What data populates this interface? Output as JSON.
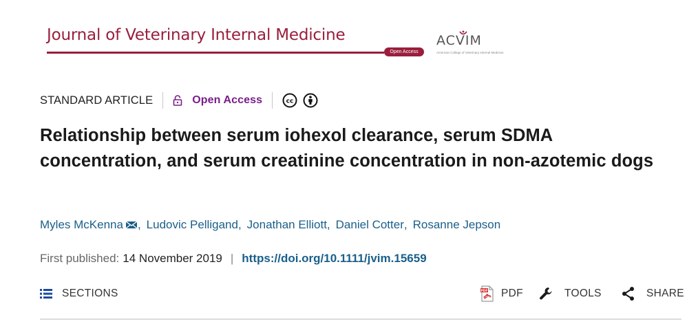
{
  "journal": {
    "title": "Journal of Veterinary Internal Medicine",
    "open_access_badge": "Open Access",
    "society_logo": "ACVIM",
    "society_name": "American College of Veterinary Internal Medicine",
    "brand_color": "#9a1e3c"
  },
  "article": {
    "type": "STANDARD ARTICLE",
    "access": "Open Access",
    "license_icons": [
      "cc-icon",
      "cc-by-icon"
    ],
    "title": "Relationship between serum iohexol clearance, serum SDMA concentration, and serum creatinine concentration in non-azotemic dogs",
    "authors": [
      {
        "name": "Myles McKenna",
        "corresponding": true
      },
      {
        "name": "Ludovic Pelligand",
        "corresponding": false
      },
      {
        "name": "Jonathan Elliott",
        "corresponding": false
      },
      {
        "name": "Daniel Cotter",
        "corresponding": false
      },
      {
        "name": "Rosanne Jepson",
        "corresponding": false
      }
    ],
    "first_published_label": "First published:",
    "first_published_date": "14 November 2019",
    "separator": "|",
    "doi": "https://doi.org/10.1111/jvim.15659"
  },
  "toolbar": {
    "sections_label": "SECTIONS",
    "pdf_label": "PDF",
    "tools_label": "TOOLS",
    "share_label": "SHARE"
  },
  "colors": {
    "link": "#1a5f8a",
    "open_access": "#7a1e8a",
    "pdf_red": "#d32f2f"
  }
}
